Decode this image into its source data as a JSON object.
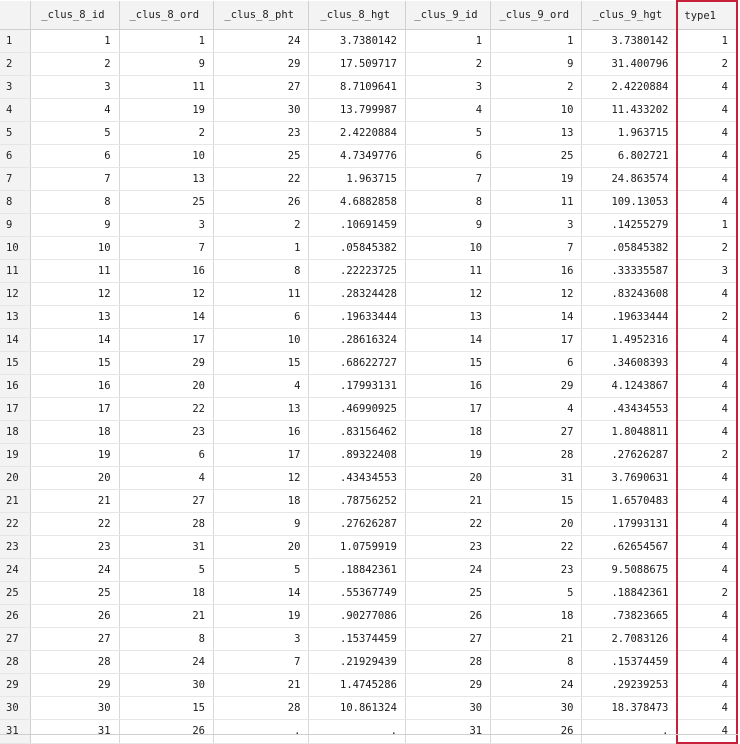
{
  "columns": [
    "_clus_8_id",
    "_clus_8_ord",
    "_clus_8_pht",
    "_clus_8_hgt",
    "_clus_9_id",
    "_clus_9_ord",
    "_clus_9_hgt",
    "type1"
  ],
  "rows": [
    [
      "1",
      "1",
      "1",
      "24",
      "3.7380142",
      "1",
      "1",
      "3.7380142",
      "1"
    ],
    [
      "2",
      "2",
      "9",
      "29",
      "17.509717",
      "2",
      "9",
      "31.400796",
      "2"
    ],
    [
      "3",
      "3",
      "11",
      "27",
      "8.7109641",
      "3",
      "2",
      "2.4220884",
      "4"
    ],
    [
      "4",
      "4",
      "19",
      "30",
      "13.799987",
      "4",
      "10",
      "11.433202",
      "4"
    ],
    [
      "5",
      "5",
      "2",
      "23",
      "2.4220884",
      "5",
      "13",
      "1.963715",
      "4"
    ],
    [
      "6",
      "6",
      "10",
      "25",
      "4.7349776",
      "6",
      "25",
      "6.802721",
      "4"
    ],
    [
      "7",
      "7",
      "13",
      "22",
      "1.963715",
      "7",
      "19",
      "24.863574",
      "4"
    ],
    [
      "8",
      "8",
      "25",
      "26",
      "4.6882858",
      "8",
      "11",
      "109.13053",
      "4"
    ],
    [
      "9",
      "9",
      "3",
      "2",
      ".10691459",
      "9",
      "3",
      ".14255279",
      "1"
    ],
    [
      "10",
      "10",
      "7",
      "1",
      ".05845382",
      "10",
      "7",
      ".05845382",
      "2"
    ],
    [
      "11",
      "11",
      "16",
      "8",
      ".22223725",
      "11",
      "16",
      ".33335587",
      "3"
    ],
    [
      "12",
      "12",
      "12",
      "11",
      ".28324428",
      "12",
      "12",
      ".83243608",
      "4"
    ],
    [
      "13",
      "13",
      "14",
      "6",
      ".19633444",
      "13",
      "14",
      ".19633444",
      "2"
    ],
    [
      "14",
      "14",
      "17",
      "10",
      ".28616324",
      "14",
      "17",
      "1.4952316",
      "4"
    ],
    [
      "15",
      "15",
      "29",
      "15",
      ".68622727",
      "15",
      "6",
      ".34608393",
      "4"
    ],
    [
      "16",
      "16",
      "20",
      "4",
      ".17993131",
      "16",
      "29",
      "4.1243867",
      "4"
    ],
    [
      "17",
      "17",
      "22",
      "13",
      ".46990925",
      "17",
      "4",
      ".43434553",
      "4"
    ],
    [
      "18",
      "18",
      "23",
      "16",
      ".83156462",
      "18",
      "27",
      "1.8048811",
      "4"
    ],
    [
      "19",
      "19",
      "6",
      "17",
      ".89322408",
      "19",
      "28",
      ".27626287",
      "2"
    ],
    [
      "20",
      "20",
      "4",
      "12",
      ".43434553",
      "20",
      "31",
      "3.7690631",
      "4"
    ],
    [
      "21",
      "21",
      "27",
      "18",
      ".78756252",
      "21",
      "15",
      "1.6570483",
      "4"
    ],
    [
      "22",
      "22",
      "28",
      "9",
      ".27626287",
      "22",
      "20",
      ".17993131",
      "4"
    ],
    [
      "23",
      "23",
      "31",
      "20",
      "1.0759919",
      "23",
      "22",
      ".62654567",
      "4"
    ],
    [
      "24",
      "24",
      "5",
      "5",
      ".18842361",
      "24",
      "23",
      "9.5088675",
      "4"
    ],
    [
      "25",
      "25",
      "18",
      "14",
      ".55367749",
      "25",
      "5",
      ".18842361",
      "2"
    ],
    [
      "26",
      "26",
      "21",
      "19",
      ".90277086",
      "26",
      "18",
      ".73823665",
      "4"
    ],
    [
      "27",
      "27",
      "8",
      "3",
      ".15374459",
      "27",
      "21",
      "2.7083126",
      "4"
    ],
    [
      "28",
      "28",
      "24",
      "7",
      ".21929439",
      "28",
      "8",
      ".15374459",
      "4"
    ],
    [
      "29",
      "29",
      "30",
      "21",
      "1.4745286",
      "29",
      "24",
      ".29239253",
      "4"
    ],
    [
      "30",
      "30",
      "15",
      "28",
      "10.861324",
      "30",
      "30",
      "18.378473",
      "4"
    ],
    [
      "31",
      "31",
      "26",
      ".",
      ".",
      "31",
      "26",
      ".",
      "4"
    ]
  ],
  "highlight": {
    "column": "type1",
    "color": "#c8203a"
  }
}
